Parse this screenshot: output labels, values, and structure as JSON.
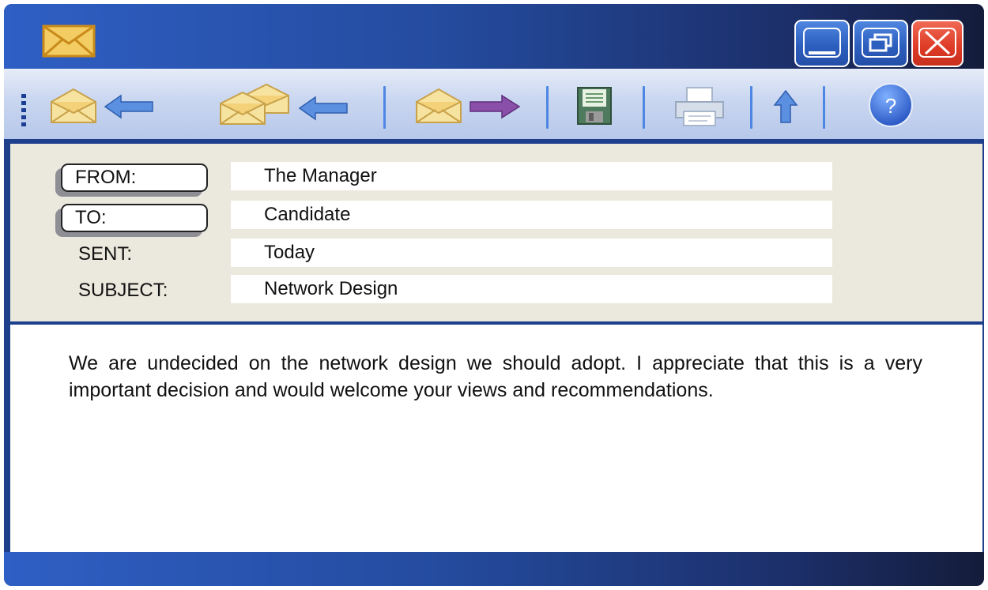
{
  "window": {
    "app_icon": "envelope-icon",
    "controls": {
      "minimize": "minimize-icon",
      "maximize": "restore-icon",
      "close": "close-icon"
    },
    "colors": {
      "frame": "#1e3f8c",
      "close": "#dd3a25",
      "accent": "#4d86e3"
    }
  },
  "toolbar": {
    "buttons": [
      {
        "icon": "reply-icon"
      },
      {
        "icon": "reply-all-icon"
      },
      {
        "icon": "forward-icon"
      },
      {
        "icon": "save-icon"
      },
      {
        "icon": "print-icon"
      },
      {
        "icon": "up-arrow-icon"
      },
      {
        "icon": "help-icon",
        "label": "?"
      }
    ]
  },
  "header": {
    "from_label": "FROM:",
    "from_value": "The Manager",
    "to_label": "TO:",
    "to_value": "Candidate",
    "sent_label": "SENT:",
    "sent_value": "Today",
    "subject_label": "SUBJECT:",
    "subject_value": "Network Design"
  },
  "body": {
    "message": "We are undecided on the network design we should adopt. I appreciate that this is a very important decision and would welcome your views and recommendations."
  }
}
